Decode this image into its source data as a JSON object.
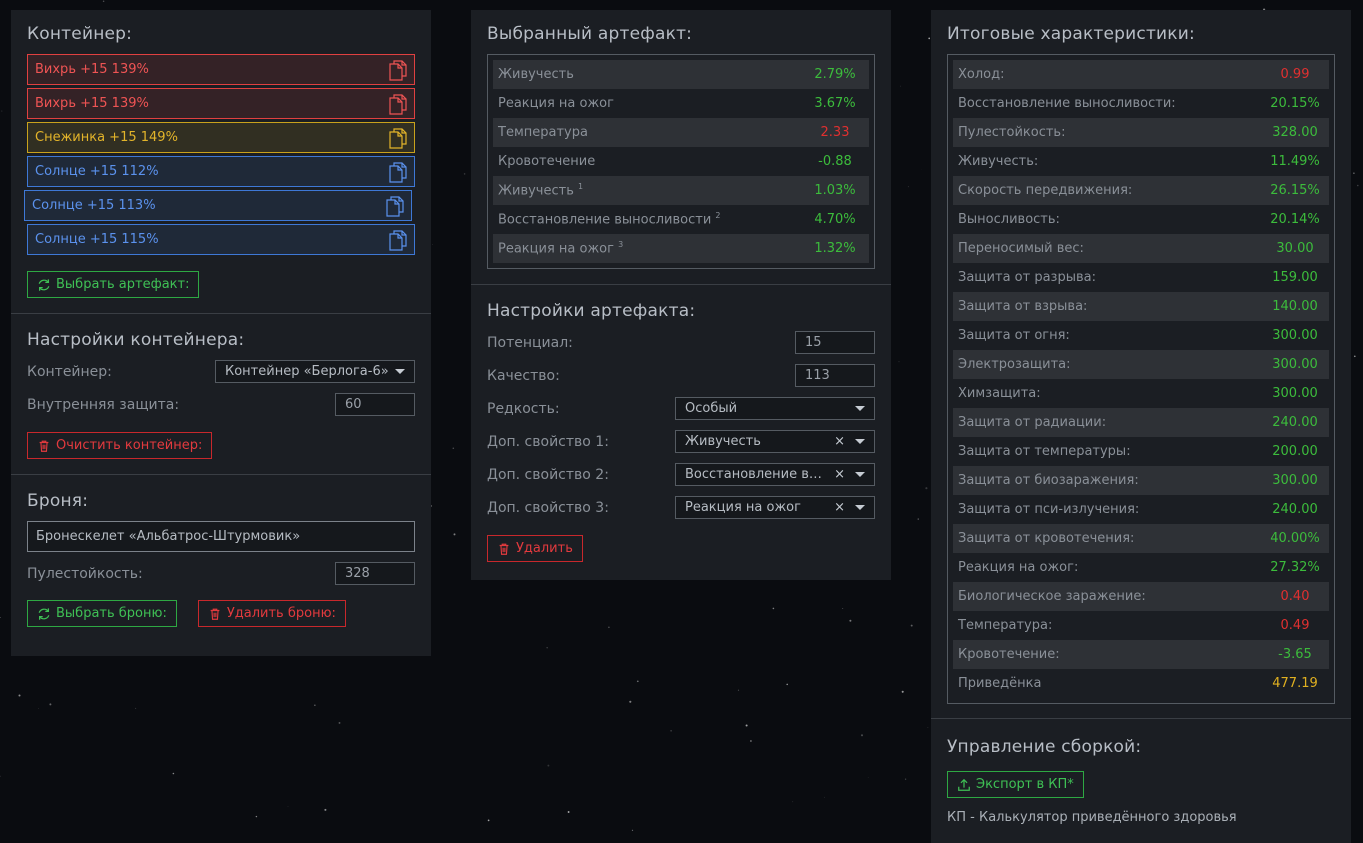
{
  "container": {
    "title": "Контейнер:",
    "artifacts": [
      {
        "label": "Вихрь +15 139%",
        "color": "red"
      },
      {
        "label": "Вихрь +15 139%",
        "color": "red"
      },
      {
        "label": "Снежинка +15 149%",
        "color": "yellow"
      },
      {
        "label": "Солнце +15 112%",
        "color": "blue"
      },
      {
        "label": "Солнце +15 113%",
        "color": "blue"
      },
      {
        "label": "Солнце +15 115%",
        "color": "blue"
      }
    ],
    "select_artifact_button": "Выбрать артефакт:"
  },
  "container_settings": {
    "title": "Настройки контейнера:",
    "container_label": "Контейнер:",
    "container_value": "Контейнер «Берлога-6»",
    "inner_protection_label": "Внутренняя защита:",
    "inner_protection_value": "60",
    "clear_button": "Очистить контейнер:"
  },
  "armor": {
    "title": "Броня:",
    "name": "Бронескелет «Альбатрос-Штурмовик»",
    "ballistic_label": "Пулестойкость:",
    "ballistic_value": "328",
    "select_button": "Выбрать броню:",
    "delete_button": "Удалить броню:"
  },
  "selected_artifact": {
    "title": "Выбранный артефакт:",
    "stats": [
      {
        "name": "Живучесть",
        "sup": "",
        "value": "2.79%",
        "color": "green"
      },
      {
        "name": "Реакция на ожог",
        "sup": "",
        "value": "3.67%",
        "color": "green"
      },
      {
        "name": "Температура",
        "sup": "",
        "value": "2.33",
        "color": "red"
      },
      {
        "name": "Кровотечение",
        "sup": "",
        "value": "-0.88",
        "color": "green"
      },
      {
        "name": "Живучесть",
        "sup": "1",
        "value": "1.03%",
        "color": "green"
      },
      {
        "name": "Восстановление выносливости",
        "sup": "2",
        "value": "4.70%",
        "color": "green"
      },
      {
        "name": "Реакция на ожог",
        "sup": "3",
        "value": "1.32%",
        "color": "green"
      }
    ]
  },
  "artifact_settings": {
    "title": "Настройки артефакта:",
    "potential_label": "Потенциал:",
    "potential_value": "15",
    "quality_label": "Качество:",
    "quality_value": "113",
    "rarity_label": "Редкость:",
    "rarity_value": "Особый",
    "extra1_label": "Доп. свойство 1:",
    "extra1_value": "Живучесть",
    "extra2_label": "Доп. свойство 2:",
    "extra2_value": "Восстановление выносливости",
    "extra3_label": "Доп. свойство 3:",
    "extra3_value": "Реакция на ожог",
    "clear_symbol": "×",
    "delete_button": "Удалить"
  },
  "totals": {
    "title": "Итоговые характеристики:",
    "stats": [
      {
        "name": "Холод:",
        "value": "0.99",
        "color": "red"
      },
      {
        "name": "Восстановление выносливости:",
        "value": "20.15%",
        "color": "green"
      },
      {
        "name": "Пулестойкость:",
        "value": "328.00",
        "color": "green"
      },
      {
        "name": "Живучесть:",
        "value": "11.49%",
        "color": "green"
      },
      {
        "name": "Скорость передвижения:",
        "value": "26.15%",
        "color": "green"
      },
      {
        "name": "Выносливость:",
        "value": "20.14%",
        "color": "green"
      },
      {
        "name": "Переносимый вес:",
        "value": "30.00",
        "color": "green"
      },
      {
        "name": "Защита от разрыва:",
        "value": "159.00",
        "color": "green"
      },
      {
        "name": "Защита от взрыва:",
        "value": "140.00",
        "color": "green"
      },
      {
        "name": "Защита от огня:",
        "value": "300.00",
        "color": "green"
      },
      {
        "name": "Электрозащита:",
        "value": "300.00",
        "color": "green"
      },
      {
        "name": "Химзащита:",
        "value": "300.00",
        "color": "green"
      },
      {
        "name": "Защита от радиации:",
        "value": "240.00",
        "color": "green"
      },
      {
        "name": "Защита от температуры:",
        "value": "200.00",
        "color": "green"
      },
      {
        "name": "Защита от биозаражения:",
        "value": "300.00",
        "color": "green"
      },
      {
        "name": "Защита от пси-излучения:",
        "value": "240.00",
        "color": "green"
      },
      {
        "name": "Защита от кровотечения:",
        "value": "40.00%",
        "color": "green"
      },
      {
        "name": "Реакция на ожог:",
        "value": "27.32%",
        "color": "green"
      },
      {
        "name": "Биологическое заражение:",
        "value": "0.40",
        "color": "red"
      },
      {
        "name": "Температура:",
        "value": "0.49",
        "color": "red"
      },
      {
        "name": "Кровотечение:",
        "value": "-3.65",
        "color": "green"
      },
      {
        "name": "Приведёнка",
        "value": "477.19",
        "color": "yellow"
      }
    ]
  },
  "build": {
    "title": "Управление сборкой:",
    "export_button": "Экспорт в КП*",
    "note": "КП - Калькулятор приведённого здоровья"
  },
  "colors": {
    "background": "#0a0c10",
    "panel": "#1b1e23",
    "green": "#3cbc3c",
    "red": "#e03030",
    "yellow": "#e0b020",
    "blue": "#5b92ee"
  }
}
